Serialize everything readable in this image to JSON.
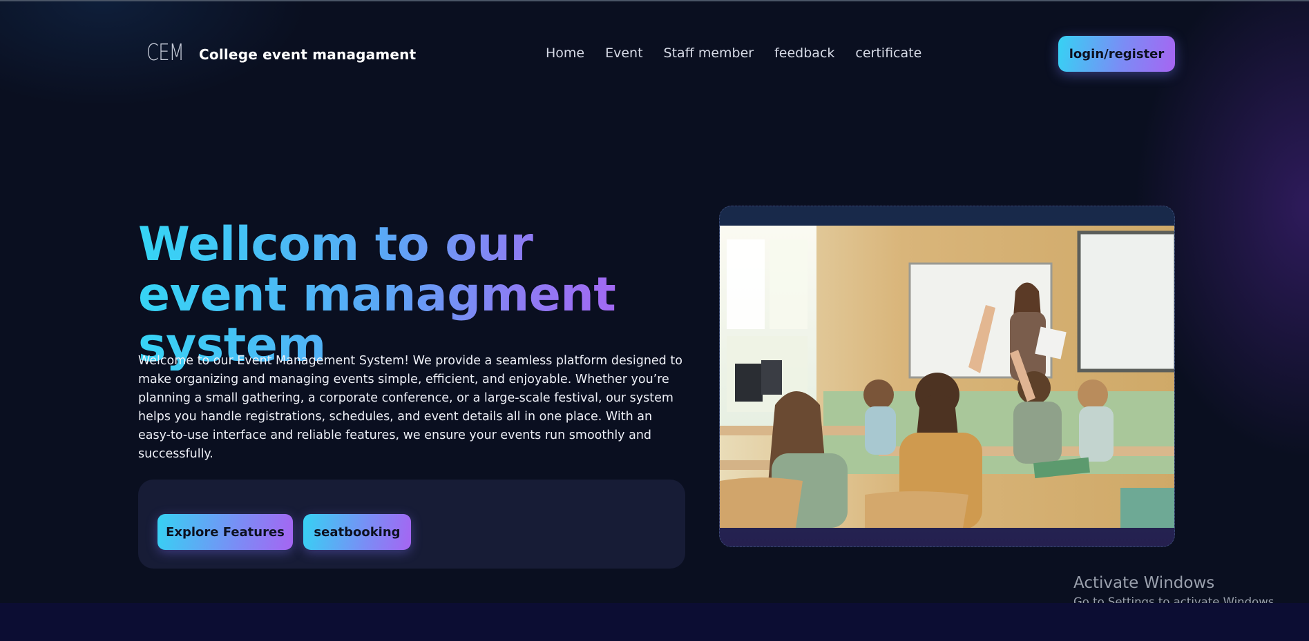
{
  "header": {
    "logo_mark": "CEM",
    "site_name": "College event managament",
    "nav": [
      {
        "label": "Home"
      },
      {
        "label": "Event"
      },
      {
        "label": "Staff member"
      },
      {
        "label": "feedback"
      },
      {
        "label": "certificate"
      }
    ],
    "login_label": "login/register"
  },
  "hero": {
    "title": "Wellcom to our event managment system",
    "description": "Welcome to our Event Management System! We provide a seamless platform designed to make organizing and managing events simple, efficient, and enjoyable. Whether you’re planning a small gathering, a corporate conference, or a large-scale festival, our system helps you handle registrations, schedules, and event details all in one place. With an easy-to-use interface and reliable features, we ensure your events run smoothly and successfully.",
    "buttons": {
      "explore": "Explore Features",
      "seat": "seatbooking"
    }
  },
  "watermark": {
    "title": "Activate Windows",
    "subtitle": "Go to Settings to activate Windows."
  },
  "colors": {
    "background": "#0a0f20",
    "accent_cyan": "#36d2f4",
    "accent_purple": "#a665f2",
    "panel": "#171c36"
  }
}
